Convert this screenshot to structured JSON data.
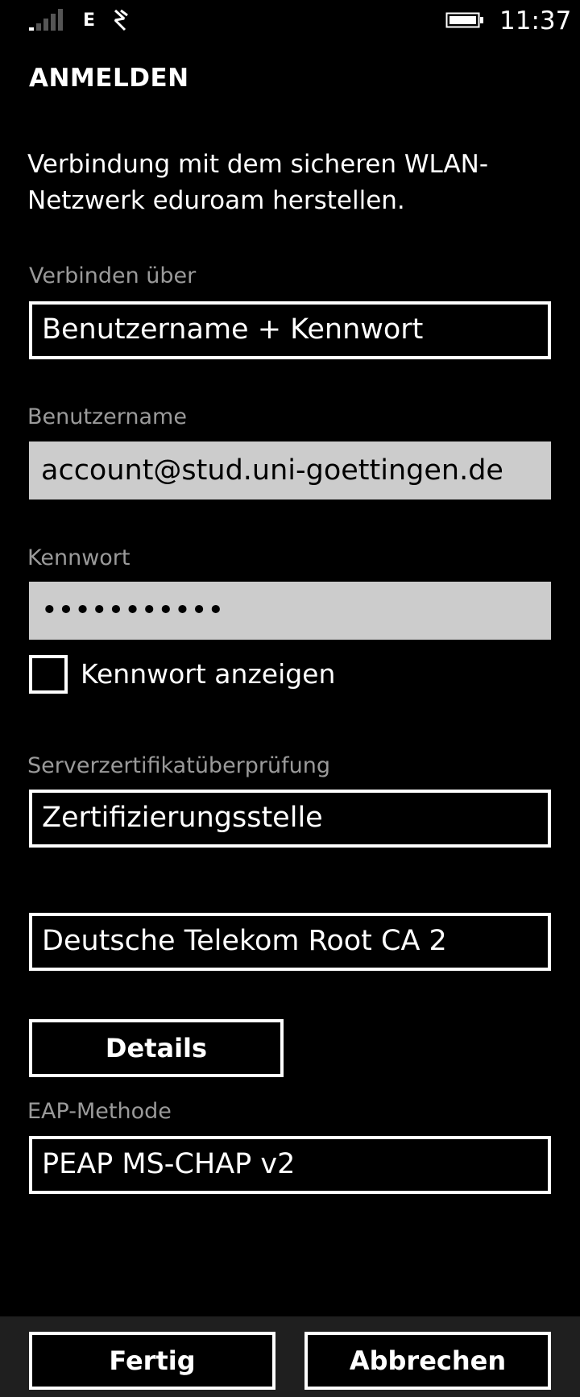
{
  "status_bar": {
    "network_type": "E",
    "time": "11:37",
    "icons": [
      "signal-strength-icon",
      "wifi-calling-icon",
      "battery-icon"
    ]
  },
  "page": {
    "title": "ANMELDEN",
    "description": "Verbindung mit dem sicheren WLAN-Netzwerk eduroam herstellen."
  },
  "form": {
    "connect_via": {
      "label": "Verbinden über",
      "value": "Benutzername + Kennwort"
    },
    "username": {
      "label": "Benutzername",
      "value": "account@stud.uni-goettingen.de"
    },
    "password": {
      "label": "Kennwort",
      "value": "•••••••••••"
    },
    "show_password": {
      "label": "Kennwort anzeigen",
      "checked": false
    },
    "server_cert": {
      "label": "Serverzertifikatüberprüfung",
      "value": "Zertifizierungsstelle"
    },
    "certificate": {
      "value": "Deutsche Telekom Root CA 2"
    },
    "details_button": {
      "label": "Details"
    },
    "eap": {
      "label": "EAP-Methode",
      "value": "PEAP MS-CHAP v2"
    }
  },
  "app_bar": {
    "done_label": "Fertig",
    "cancel_label": "Abbrechen"
  },
  "colors": {
    "background": "#000000",
    "foreground": "#ffffff",
    "label": "#9a9a9a",
    "textbox_bg": "#cccccc",
    "app_bar_bg": "#1f1f1f"
  }
}
